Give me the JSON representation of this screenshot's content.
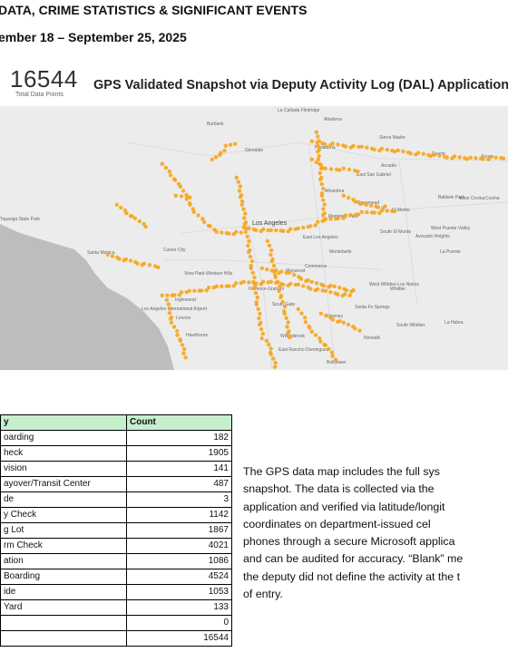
{
  "header": {
    "line1": "DATA, CRIME STATISTICS & SIGNIFICANT EVENTS",
    "line2": "ember 18 – September 25, 2025"
  },
  "total": {
    "value": "16544",
    "label": "Total Data Points"
  },
  "map": {
    "title": "GPS Validated Snapshot via Deputy Activity Log (DAL) Application",
    "labels": {
      "la_canada": "La Cañada Flintridge",
      "altadena": "Altadena",
      "sierra_madre": "Sierra Madre",
      "burbank": "Burbank",
      "glendale": "Glendale",
      "pasadena": "Pasadena",
      "arcadia": "Arcadia",
      "duarte": "Duarte",
      "azusa": "Azusa",
      "east_san_gabriel": "East San Gabriel",
      "alhambra": "Alhambra",
      "rosemead": "Rosemead",
      "el_monte": "El Monte",
      "baldwin_park": "Baldwin Park",
      "west_covina": "West Covina",
      "covina": "Covina",
      "topanga": "Topanga State Park",
      "los_angeles": "Los Angeles",
      "monterey_park": "Monterey Park",
      "south_el_monte": "South El Monte",
      "west_puente": "West Puente Valley",
      "avocado": "Avocado Heights",
      "la_puente": "La Puente",
      "culver_city": "Culver City",
      "santa_monica": "Santa Monica",
      "east_la": "East Los Angeles",
      "montebello": "Montebello",
      "view_park": "View Park-Windsor Hills",
      "maywood": "Maywood",
      "commerce": "Commerce",
      "florence": "Florence-Graham",
      "south_gate": "South Gate",
      "west_whittier": "West Whittier-Los Nietos",
      "whittier": "Whittier",
      "inglewood": "Inglewood",
      "lax": "Los Angeles International Airport",
      "lennox": "Lennox",
      "hawthorne": "Hawthorne",
      "downey": "Downey",
      "santa_fe": "Santa Fe Springs",
      "la_habra": "La Habra",
      "willowbrook": "Willowbrook",
      "norwalk": "Norwalk",
      "south_whittier": "South Whittier",
      "east_rancho": "East Rancho Dominguez",
      "bellflower": "Bellflower"
    }
  },
  "table": {
    "headers": {
      "activity": "y",
      "count": "Count"
    },
    "rows": [
      {
        "activity": "oarding",
        "count": "182"
      },
      {
        "activity": "heck",
        "count": "1905"
      },
      {
        "activity": "vision",
        "count": "141"
      },
      {
        "activity": "ayover/Transit Center",
        "count": "487"
      },
      {
        "activity": "de",
        "count": "3"
      },
      {
        "activity": "y Check",
        "count": "1142"
      },
      {
        "activity": "g Lot",
        "count": "1867"
      },
      {
        "activity": "rm Check",
        "count": "4021"
      },
      {
        "activity": "ation",
        "count": "1086"
      },
      {
        "activity": "Boarding",
        "count": "4524"
      },
      {
        "activity": "ide",
        "count": "1053"
      },
      {
        "activity": "Yard",
        "count": "133"
      },
      {
        "activity": "",
        "count": "0"
      },
      {
        "activity": "",
        "count": "16544"
      }
    ]
  },
  "paragraph": {
    "lines": [
      "The GPS data map includes the full sys",
      "snapshot. The data is collected via the",
      "application and verified via latitude/longit",
      "coordinates on department-issued cel",
      "phones through a secure Microsoft applica",
      "and can be audited for accuracy. “Blank” me",
      "the deputy did not define the activity at the t",
      "of entry."
    ]
  },
  "colors": {
    "dot": "#f7a51c",
    "ocean": "#bdbdbd",
    "land": "#ececec",
    "table_header": "#c6efce"
  }
}
